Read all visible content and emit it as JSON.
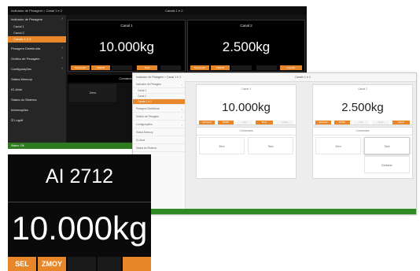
{
  "dark_window": {
    "title_left": "Indicador de Pesagem > Canal 1 e 2",
    "title_center": "Canais 1 e 2",
    "sidebar": {
      "items": [
        {
          "label": "Indicador de Pesagem",
          "has_chevron": true
        },
        {
          "label": "Canal 1"
        },
        {
          "label": "Canal 2"
        },
        {
          "label": "Canais 1 e 2",
          "active": true
        },
        {
          "label": "Pesagem Distribuída",
          "has_chevron": true
        },
        {
          "label": "Gráfico de Pesagem",
          "has_chevron": true
        },
        {
          "label": "Configurações",
          "has_chevron": true
        },
        {
          "label": "Status Memory"
        },
        {
          "label": "IO-Aisle"
        },
        {
          "label": "Status do Sistema"
        },
        {
          "label": "Informações"
        },
        {
          "label": "Logoff"
        }
      ]
    },
    "channel1": {
      "title": "Canal 1",
      "value": "10.000kg",
      "buttons": [
        "Selecionar",
        "ZERAR",
        "",
        "Tarar",
        ""
      ]
    },
    "channel2": {
      "title": "Canal 2",
      "value": "2.500kg",
      "buttons": [
        "Selecionar",
        "ZERAR",
        "",
        "",
        "Liquidar"
      ]
    },
    "commands_label": "Comandos",
    "zero_label": "Zero",
    "status_text": "Status: OK"
  },
  "light_window": {
    "title_left": "Indicador de Pesagem > Canal 1 e 2",
    "title_center": "Canais 1 e 2",
    "sidebar": {
      "items": [
        {
          "label": "Indicador de Pesagem",
          "has_chevron": true
        },
        {
          "label": "Canal 1"
        },
        {
          "label": "Canal 2"
        },
        {
          "label": "Canais 1 e 2",
          "active": true
        },
        {
          "label": "Pesagem Distribuída",
          "has_chevron": true
        },
        {
          "label": "Gráfico de Pesagem",
          "has_chevron": true
        },
        {
          "label": "Configurações",
          "has_chevron": true
        },
        {
          "label": "Status Memory"
        },
        {
          "label": "IO-Aisle"
        },
        {
          "label": "Status do Sistema"
        }
      ]
    },
    "channel1": {
      "title": "Canal 1",
      "value": "10.000kg",
      "buttons": [
        "Selecionar",
        "ZERAR",
        "Tara",
        "Bruto",
        "Liquido"
      ]
    },
    "channel2": {
      "title": "Canal 2",
      "value": "2.500kg",
      "buttons": [
        "Selecionar",
        "ZERAR",
        "Tara",
        "Bruto",
        "Liquido"
      ]
    },
    "commands": {
      "label": "Comandos",
      "left_buttons": [
        "Zero",
        "Tara"
      ],
      "right_buttons": [
        "Zero",
        "Tara"
      ],
      "right_extra": "Destarar"
    }
  },
  "zoom_panel": {
    "device_name": "AI 2712",
    "value": "10.000kg",
    "buttons": [
      "SEL",
      "ZMOY",
      "",
      "",
      ""
    ]
  },
  "colors": {
    "accent": "#e8872a",
    "status_green": "#2f8a24",
    "dark_bg": "#141414",
    "light_bg": "#ededed"
  }
}
